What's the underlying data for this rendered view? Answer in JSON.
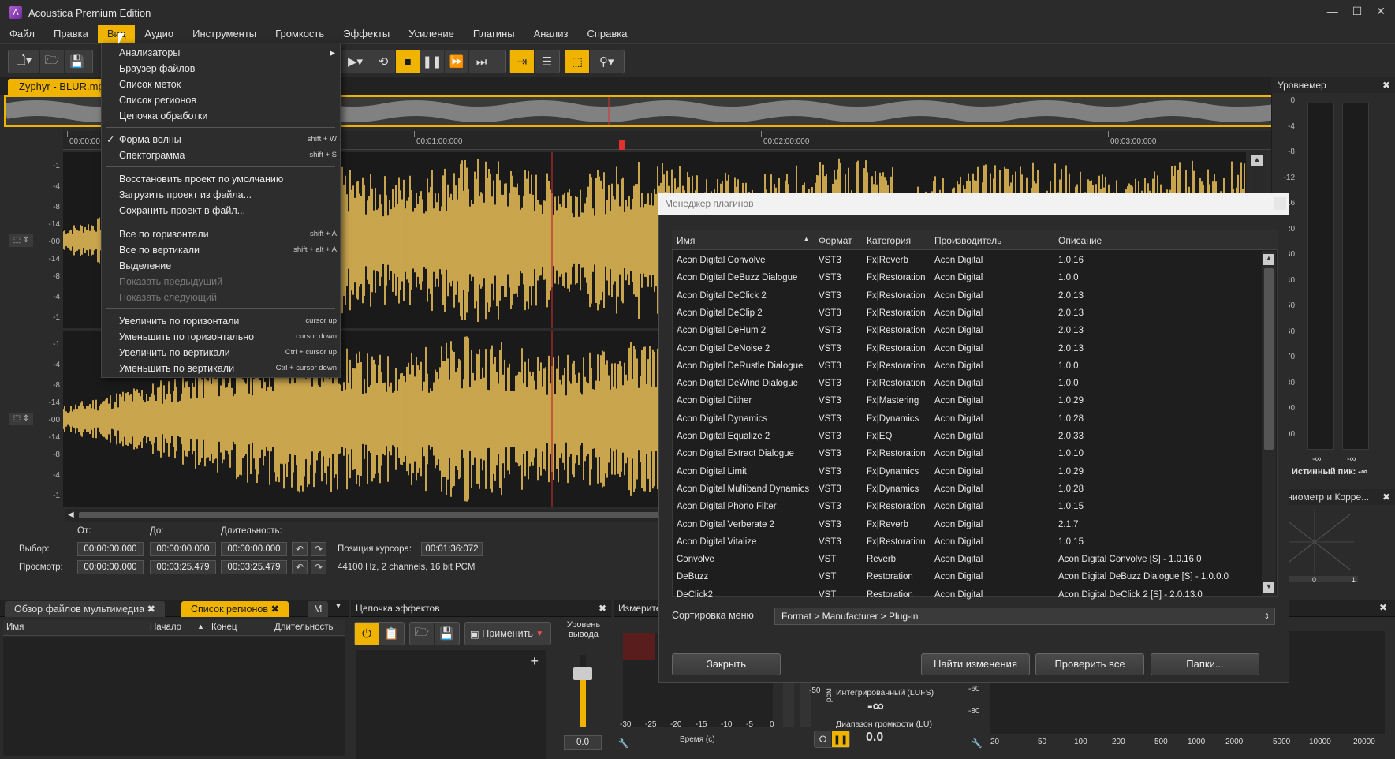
{
  "app": {
    "title": "Acoustica Premium Edition",
    "accent": "#f0b400"
  },
  "menubar": [
    "Файл",
    "Правка",
    "Вид",
    "Аудио",
    "Инструменты",
    "Громкость",
    "Эффекты",
    "Усиление",
    "Плагины",
    "Анализ",
    "Справка"
  ],
  "document_tab": "Zyphyr - BLUR.mp3",
  "ruler": {
    "ticks": [
      "00:00:00",
      "00:01:00:000",
      "00:02:00:000",
      "00:03:00:000"
    ]
  },
  "wave_scale": [
    "-1",
    "-4",
    "-8",
    "-14",
    "-00",
    "-14",
    "-8",
    "-4",
    "-1"
  ],
  "view_menu": {
    "items": [
      {
        "label": "Анализаторы",
        "shortcut": "",
        "has_submenu": true
      },
      {
        "label": "Браузер файлов",
        "shortcut": ""
      },
      {
        "label": "Список меток",
        "shortcut": ""
      },
      {
        "label": "Список регионов",
        "shortcut": ""
      },
      {
        "label": "Цепочка обработки",
        "shortcut": ""
      },
      {
        "label": "Форма волны",
        "shortcut": "shift + W",
        "checked": true
      },
      {
        "label": "Спектограмма",
        "shortcut": "shift + S"
      },
      {
        "label": "Восстановить проект по умолчанию",
        "shortcut": ""
      },
      {
        "label": "Загрузить проект из файла...",
        "shortcut": ""
      },
      {
        "label": "Сохранить проект в файл...",
        "shortcut": ""
      },
      {
        "label": "Все по горизонтали",
        "shortcut": "shift + A"
      },
      {
        "label": "Все по вертикали",
        "shortcut": "shift + alt + A"
      },
      {
        "label": "Выделение",
        "shortcut": ""
      },
      {
        "label": "Показать предыдущий",
        "shortcut": "",
        "disabled": true
      },
      {
        "label": "Показать следующий",
        "shortcut": "",
        "disabled": true
      },
      {
        "label": "Увеличить по горизонтали",
        "shortcut": "cursor up"
      },
      {
        "label": "Уменьшить по горизонтально",
        "shortcut": "cursor down"
      },
      {
        "label": "Увеличить по вертикали",
        "shortcut": "Ctrl + cursor up"
      },
      {
        "label": "Уменьшить по вертикали",
        "shortcut": "Ctrl + cursor down"
      }
    ]
  },
  "selection": {
    "from_label": "От:",
    "to_label": "До:",
    "length_label": "Длительность:",
    "select_label": "Выбор:",
    "preview_label": "Просмотр:",
    "select_from": "00:00:00.000",
    "select_to": "00:00:00.000",
    "select_len": "00:00:00.000",
    "preview_from": "00:00:00.000",
    "preview_to": "00:03:25.479",
    "preview_len": "00:03:25.479",
    "cursor_label": "Позиция курсора:",
    "cursor_value": "00:01:36:072",
    "format": "44100 Hz, 2 channels, 16 bit PCM"
  },
  "meter": {
    "title": "Уровнемер",
    "scale": [
      "0",
      "-4",
      "-8",
      "-12",
      "-16",
      "-20",
      "-30",
      "-40",
      "-50",
      "-60",
      "-70",
      "-80",
      "-90",
      "-100"
    ],
    "left_val": "-∞",
    "right_val": "-∞",
    "true_peak": "Истинный пик: -∞"
  },
  "gonio": {
    "title": "Гониометр и Корре...",
    "axis": [
      "-1",
      "0",
      "1"
    ]
  },
  "plugin_manager": {
    "title": "Менеджер плагинов",
    "columns": [
      "Имя",
      "Формат",
      "Категория",
      "Производитель",
      "Описание"
    ],
    "rows": [
      [
        "Acon Digital Convolve",
        "VST3",
        "Fx|Reverb",
        "Acon Digital",
        "1.0.16"
      ],
      [
        "Acon Digital DeBuzz Dialogue",
        "VST3",
        "Fx|Restoration",
        "Acon Digital",
        "1.0.0"
      ],
      [
        "Acon Digital DeClick 2",
        "VST3",
        "Fx|Restoration",
        "Acon Digital",
        "2.0.13"
      ],
      [
        "Acon Digital DeClip 2",
        "VST3",
        "Fx|Restoration",
        "Acon Digital",
        "2.0.13"
      ],
      [
        "Acon Digital DeHum 2",
        "VST3",
        "Fx|Restoration",
        "Acon Digital",
        "2.0.13"
      ],
      [
        "Acon Digital DeNoise 2",
        "VST3",
        "Fx|Restoration",
        "Acon Digital",
        "2.0.13"
      ],
      [
        "Acon Digital DeRustle Dialogue",
        "VST3",
        "Fx|Restoration",
        "Acon Digital",
        "1.0.0"
      ],
      [
        "Acon Digital DeWind Dialogue",
        "VST3",
        "Fx|Restoration",
        "Acon Digital",
        "1.0.0"
      ],
      [
        "Acon Digital Dither",
        "VST3",
        "Fx|Mastering",
        "Acon Digital",
        "1.0.29"
      ],
      [
        "Acon Digital Dynamics",
        "VST3",
        "Fx|Dynamics",
        "Acon Digital",
        "1.0.28"
      ],
      [
        "Acon Digital Equalize 2",
        "VST3",
        "Fx|EQ",
        "Acon Digital",
        "2.0.33"
      ],
      [
        "Acon Digital Extract Dialogue",
        "VST3",
        "Fx|Restoration",
        "Acon Digital",
        "1.0.10"
      ],
      [
        "Acon Digital Limit",
        "VST3",
        "Fx|Dynamics",
        "Acon Digital",
        "1.0.29"
      ],
      [
        "Acon Digital Multiband Dynamics",
        "VST3",
        "Fx|Dynamics",
        "Acon Digital",
        "1.0.28"
      ],
      [
        "Acon Digital Phono Filter",
        "VST3",
        "Fx|Restoration",
        "Acon Digital",
        "1.0.15"
      ],
      [
        "Acon Digital Verberate 2",
        "VST3",
        "Fx|Reverb",
        "Acon Digital",
        "2.1.7"
      ],
      [
        "Acon Digital Vitalize",
        "VST3",
        "Fx|Restoration",
        "Acon Digital",
        "1.0.15"
      ],
      [
        "Convolve",
        "VST",
        "Reverb",
        "Acon Digital",
        "Acon Digital Convolve [S] - 1.0.16.0"
      ],
      [
        "DeBuzz",
        "VST",
        "Restoration",
        "Acon Digital",
        "Acon Digital DeBuzz Dialogue [S] - 1.0.0.0"
      ],
      [
        "DeClick2",
        "VST",
        "Restoration",
        "Acon Digital",
        "Acon Digital DeClick 2 [S] - 2.0.13.0"
      ]
    ],
    "sort_label": "Сортировка меню",
    "sort_value": "Format > Manufacturer > Plug-in",
    "buttons": {
      "close": "Закрыть",
      "find": "Найти изменения",
      "check": "Проверить все",
      "folders": "Папки..."
    }
  },
  "bottom": {
    "tab_media": "Обзор файлов мультимедиа",
    "tab_regions": "Список регионов",
    "tab_m": "М",
    "cols": [
      "Имя",
      "Начало",
      "Конец",
      "Длительность"
    ],
    "chain_title": "Цепочка эффектов",
    "apply": "Применить",
    "out_level": "Уровень вывода",
    "out_value": "0.0",
    "measure_title": "Измерите",
    "time_label": "Время (с)",
    "time_ticks": [
      "-30",
      "-25",
      "-20",
      "-15",
      "-10",
      "-5",
      "0"
    ],
    "loud_label": "Гром",
    "loud_tick": "-50",
    "integrated_label": "Интегрированный (LUFS)",
    "integrated_val": "-∞",
    "range_label": "Диапазон громкости (LU)",
    "range_val": "0.0",
    "spec_ticks": [
      "20",
      "50",
      "100",
      "200",
      "500",
      "1000",
      "2000",
      "5000",
      "10000",
      "20000"
    ],
    "spec_y": [
      "-60",
      "-80"
    ]
  }
}
